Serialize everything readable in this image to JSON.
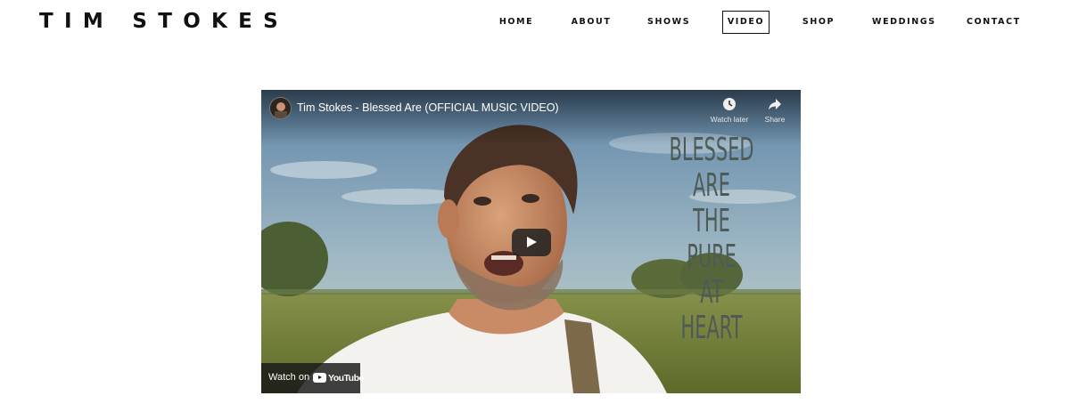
{
  "site": {
    "logo": "TIM STOKES"
  },
  "nav": {
    "items": [
      {
        "label": "HOME"
      },
      {
        "label": "ABOUT"
      },
      {
        "label": "SHOWS"
      },
      {
        "label": "VIDEO",
        "active": true
      },
      {
        "label": "SHOP"
      },
      {
        "label": "WEDDINGS"
      },
      {
        "label": "CONTACT"
      }
    ]
  },
  "video": {
    "title": "Tim Stokes - Blessed Are (OFFICIAL MUSIC VIDEO)",
    "watch_later_label": "Watch later",
    "share_label": "Share",
    "watch_on_label": "Watch on",
    "youtube_label": "YouTube",
    "overlay_line1": "BLESSED ARE",
    "overlay_line2": "THE PURE",
    "overlay_line3_a": "AT ",
    "overlay_line3_b": "HEART",
    "icons": {
      "watch_later": "clock-icon",
      "share": "share-arrow-icon",
      "play": "play-icon",
      "youtube": "youtube-logo-icon"
    }
  },
  "colors": {
    "text": "#111111",
    "overlay_text": "#4e5a55",
    "play_button": "#212121"
  }
}
